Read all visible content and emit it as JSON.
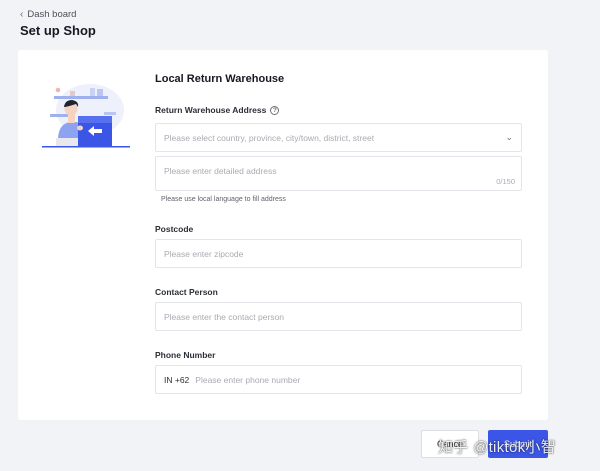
{
  "header": {
    "back_label": "Dash board",
    "title": "Set up Shop"
  },
  "form": {
    "section_title": "Local Return Warehouse",
    "address": {
      "label": "Return Warehouse Address",
      "select_placeholder": "Please select country, province, city/town, district, street",
      "detail_placeholder": "Please enter detailed address",
      "counter": "0/150",
      "hint": "Please use local language to fill address"
    },
    "postcode": {
      "label": "Postcode",
      "placeholder": "Please enter zipcode"
    },
    "contact": {
      "label": "Contact Person",
      "placeholder": "Please enter the contact person"
    },
    "phone": {
      "label": "Phone Number",
      "prefix": "IN +62",
      "placeholder": "Please enter phone number"
    }
  },
  "footer": {
    "cancel_label": "Cance",
    "submit_label": "Submit"
  },
  "watermark": "知乎 @tiktok小智",
  "colors": {
    "primary": "#3b55e6",
    "background": "#f2f3f7",
    "card": "#ffffff",
    "border": "#e3e5ea"
  }
}
